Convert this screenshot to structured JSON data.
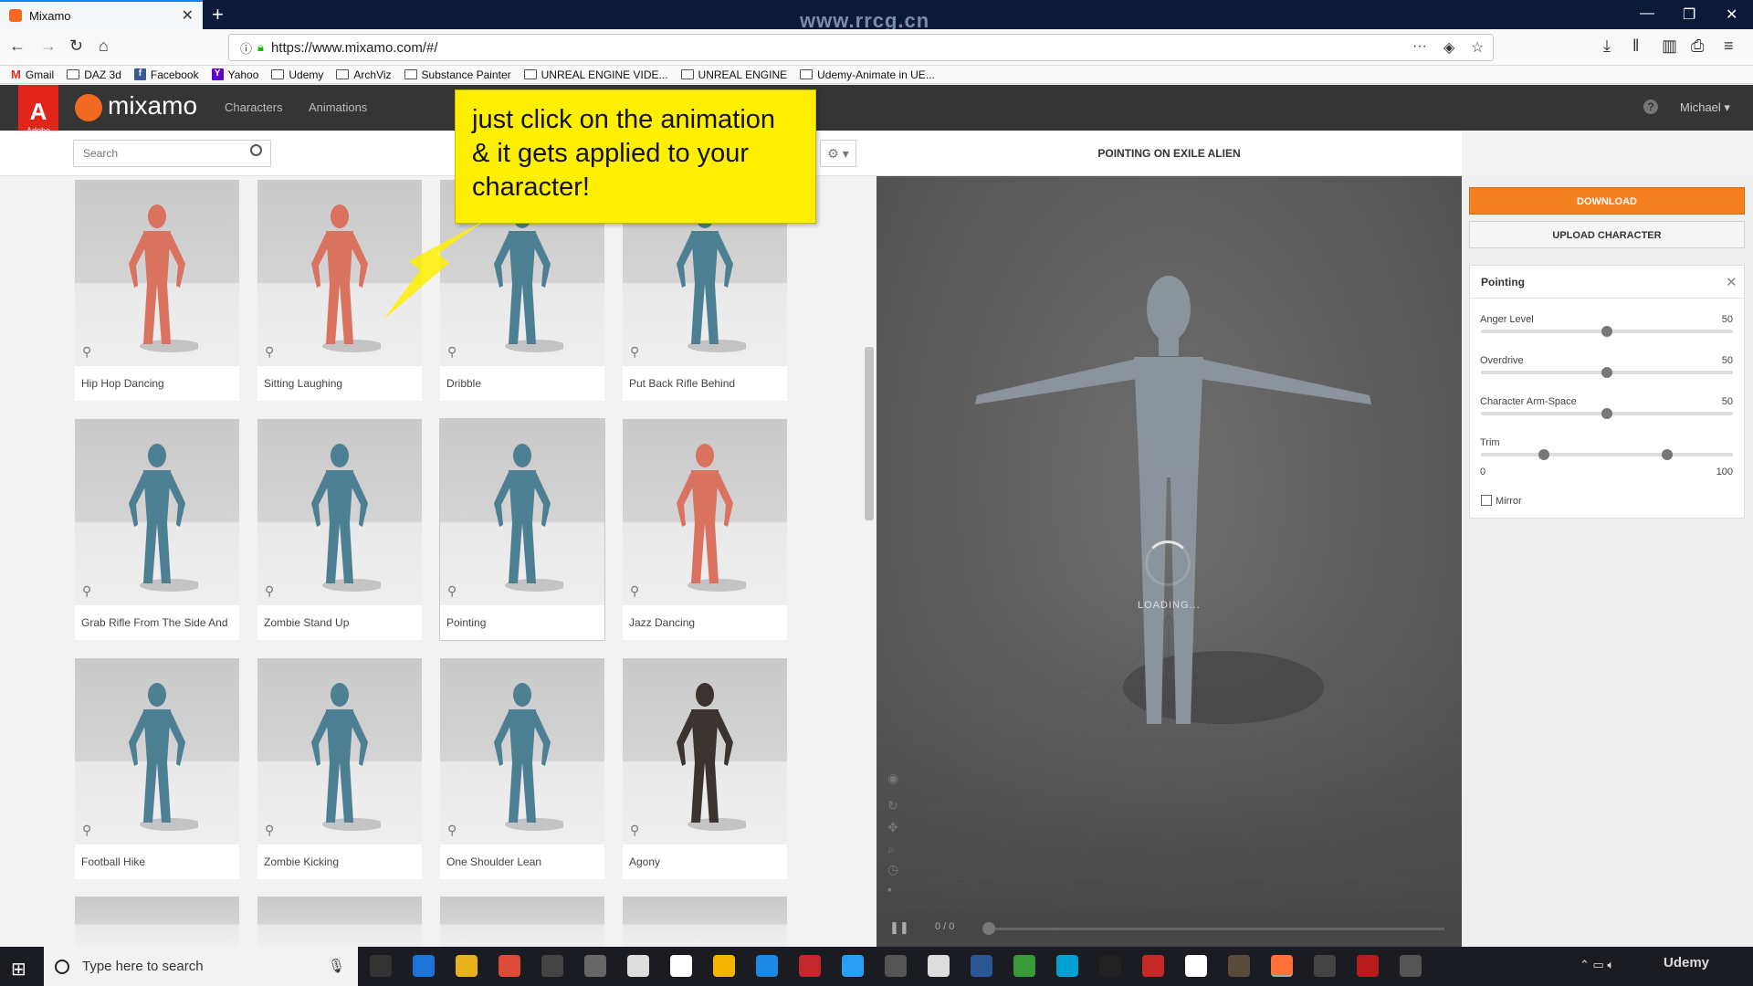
{
  "browser": {
    "tab_title": "Mixamo",
    "url": "https://www.mixamo.com/#/",
    "watermark": "www.rrcg.cn",
    "bookmarks": [
      {
        "label": "Gmail",
        "icon": "gmail-icon"
      },
      {
        "label": "DAZ 3d",
        "icon": "folder-icon"
      },
      {
        "label": "Facebook",
        "icon": "facebook-icon"
      },
      {
        "label": "Yahoo",
        "icon": "yahoo-icon"
      },
      {
        "label": "Udemy",
        "icon": "folder-icon"
      },
      {
        "label": "ArchViz",
        "icon": "folder-icon"
      },
      {
        "label": "Substance Painter",
        "icon": "folder-icon"
      },
      {
        "label": "UNREAL ENGINE VIDE...",
        "icon": "folder-icon"
      },
      {
        "label": "UNREAL ENGINE",
        "icon": "folder-icon"
      },
      {
        "label": "Udemy-Animate in UE...",
        "icon": "folder-icon"
      }
    ]
  },
  "header": {
    "adobe_label": "Adobe",
    "logo": "mixamo",
    "nav": [
      "Characters",
      "Animations"
    ],
    "user": "Michael",
    "accent_color": "#f26a21"
  },
  "search": {
    "placeholder": "Search"
  },
  "callout": {
    "text": "just click on the animation & it gets applied to your character!"
  },
  "animations": [
    {
      "label": "Hip Hop Dancing",
      "color": "#d9725f"
    },
    {
      "label": "Sitting Laughing",
      "color": "#d9725f"
    },
    {
      "label": "Dribble",
      "color": "#4d7f93"
    },
    {
      "label": "Put Back Rifle Behind",
      "color": "#4d7f93"
    },
    {
      "label": "Grab Rifle From The Side And",
      "color": "#4d7f93"
    },
    {
      "label": "Zombie Stand Up",
      "color": "#4d7f93"
    },
    {
      "label": "Pointing",
      "color": "#4d7f93",
      "selected": true
    },
    {
      "label": "Jazz Dancing",
      "color": "#d9725f"
    },
    {
      "label": "Football Hike",
      "color": "#4d7f93"
    },
    {
      "label": "Zombie Kicking",
      "color": "#4d7f93"
    },
    {
      "label": "One Shoulder Lean",
      "color": "#4d7f93"
    },
    {
      "label": "Agony",
      "color": "#3a3330"
    }
  ],
  "viewer": {
    "title": "POINTING ON EXILE ALIEN",
    "loading_text": "LOADING...",
    "time": "0 / 0"
  },
  "panel": {
    "download_label": "DOWNLOAD",
    "upload_label": "UPLOAD CHARACTER",
    "settings_title": "Pointing",
    "sliders": [
      {
        "label": "Anger Level",
        "value": 50
      },
      {
        "label": "Overdrive",
        "value": 50
      },
      {
        "label": "Character Arm-Space",
        "value": 50
      }
    ],
    "trim": {
      "label": "Trim",
      "min": 0,
      "max": 100,
      "start": 25,
      "end": 74
    },
    "mirror_label": "Mirror",
    "mirror_checked": false
  },
  "taskbar": {
    "search_placeholder": "Type here to search",
    "tray_label": "Udemy"
  }
}
